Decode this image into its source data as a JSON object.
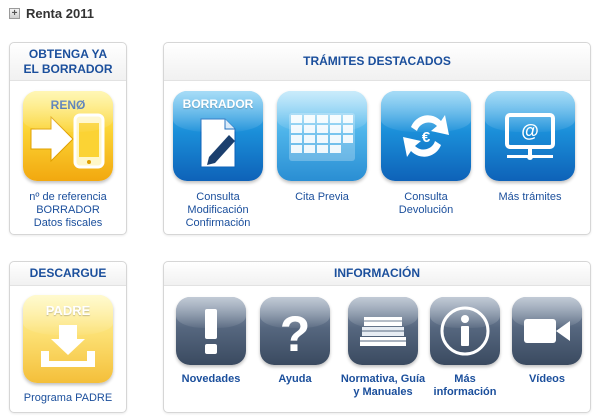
{
  "page": {
    "title": "Renta 2011",
    "expand_symbol": "+"
  },
  "borrador_panel": {
    "heading_line1": "OBTENGA YA",
    "heading_line2": "EL BORRADOR",
    "icon_label": "RENØ",
    "caption_lines": [
      "nº de referencia",
      "BORRADOR",
      "Datos fiscales"
    ]
  },
  "tramites_panel": {
    "heading": "TRÁMITES DESTACADOS",
    "items": [
      {
        "icon_label": "BORRADOR",
        "caption_lines": [
          "Consulta",
          "Modificación",
          "Confirmación"
        ]
      },
      {
        "caption_lines": [
          "Cita Previa"
        ]
      },
      {
        "caption_lines": [
          "Consulta",
          "Devolución"
        ]
      },
      {
        "caption_lines": [
          "Más trámites"
        ]
      }
    ]
  },
  "descargue_panel": {
    "heading": "DESCARGUE",
    "icon_label": "PADRE",
    "caption": "Programa PADRE"
  },
  "informacion_panel": {
    "heading": "INFORMACIÓN",
    "items": [
      {
        "caption_lines": [
          "Novedades"
        ]
      },
      {
        "caption_lines": [
          "Ayuda"
        ]
      },
      {
        "caption_lines": [
          "Normativa, Guía",
          "y Manuales"
        ]
      },
      {
        "caption_lines": [
          "Más",
          "información"
        ]
      },
      {
        "caption_lines": [
          "Vídeos"
        ]
      }
    ]
  },
  "colors": {
    "heading_text": "#1b4f9c",
    "title_text": "#333333",
    "icon_blue": "#1b8fd9",
    "icon_yellow": "#fbd334",
    "icon_slate": "#56677f"
  }
}
